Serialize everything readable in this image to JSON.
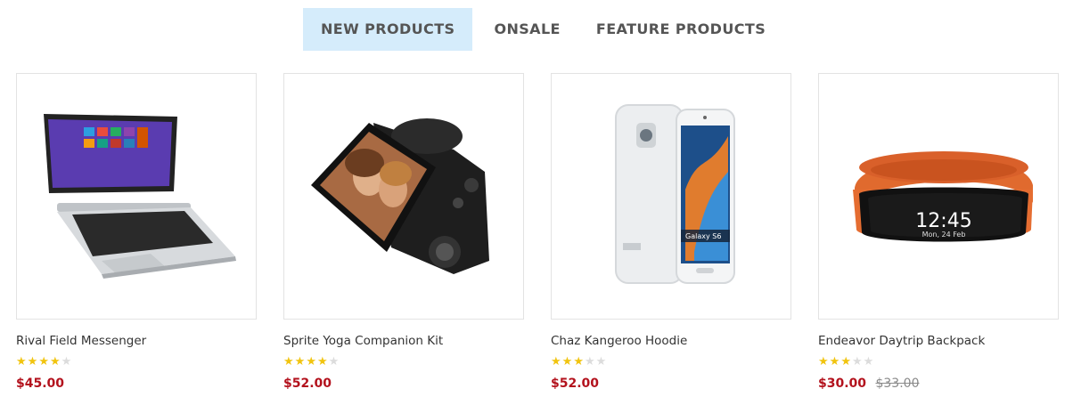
{
  "tabs": [
    {
      "label": "NEW PRODUCTS",
      "active": true
    },
    {
      "label": "ONSALE",
      "active": false
    },
    {
      "label": "FEATURE PRODUCTS",
      "active": false
    }
  ],
  "products": [
    {
      "name": "Rival Field Messenger",
      "rating": 4,
      "max_rating": 5,
      "price": "$45.00",
      "old_price": "",
      "image_icon": "laptop-tablet"
    },
    {
      "name": "Sprite Yoga Companion Kit",
      "rating": 4,
      "max_rating": 5,
      "price": "$52.00",
      "old_price": "",
      "image_icon": "camera"
    },
    {
      "name": "Chaz Kangeroo Hoodie",
      "rating": 3,
      "max_rating": 5,
      "price": "$52.00",
      "old_price": "",
      "image_icon": "smartphone",
      "phone_brand_text": "Galaxy S6"
    },
    {
      "name": "Endeavor Daytrip Backpack",
      "rating": 3,
      "max_rating": 5,
      "price": "$30.00",
      "old_price": "$33.00",
      "image_icon": "fitness-band",
      "watch_time": "12:45",
      "watch_date": "Mon, 24 Feb"
    }
  ],
  "colors": {
    "accent_tab_bg": "#d5ecfb",
    "price": "#b3121d",
    "star": "#f1c40f"
  }
}
